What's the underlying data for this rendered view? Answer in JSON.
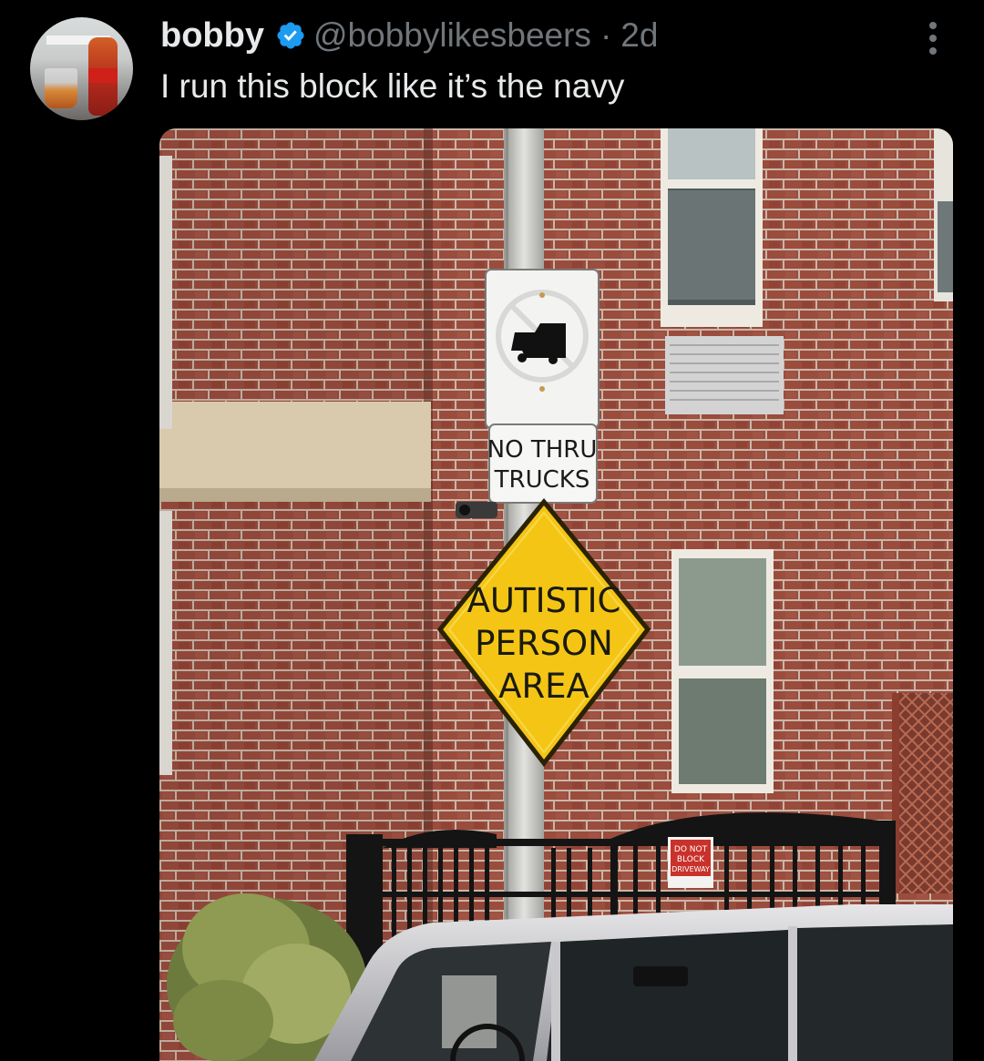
{
  "tweet": {
    "display_name": "bobby",
    "handle": "@bobbylikesbeers",
    "separator": "·",
    "age": "2d",
    "text": "I run this block like it’s the navy",
    "verified": true
  },
  "icons": {
    "verified": "verified-badge-icon",
    "more": "more-vertical-icon"
  },
  "colors": {
    "background": "#000000",
    "text_primary": "#e7e9ea",
    "text_secondary": "#71767b",
    "verified_blue": "#1d9bf0"
  },
  "photo": {
    "sign_top_line1": "NO THRU",
    "sign_top_line2": "TRUCKS",
    "warning_line1": "AUTISTIC",
    "warning_line2": "PERSON",
    "warning_line3": "AREA",
    "small_sign_line1": "DO NOT",
    "small_sign_line2": "BLOCK",
    "small_sign_line3": "DRIVEWAY"
  }
}
